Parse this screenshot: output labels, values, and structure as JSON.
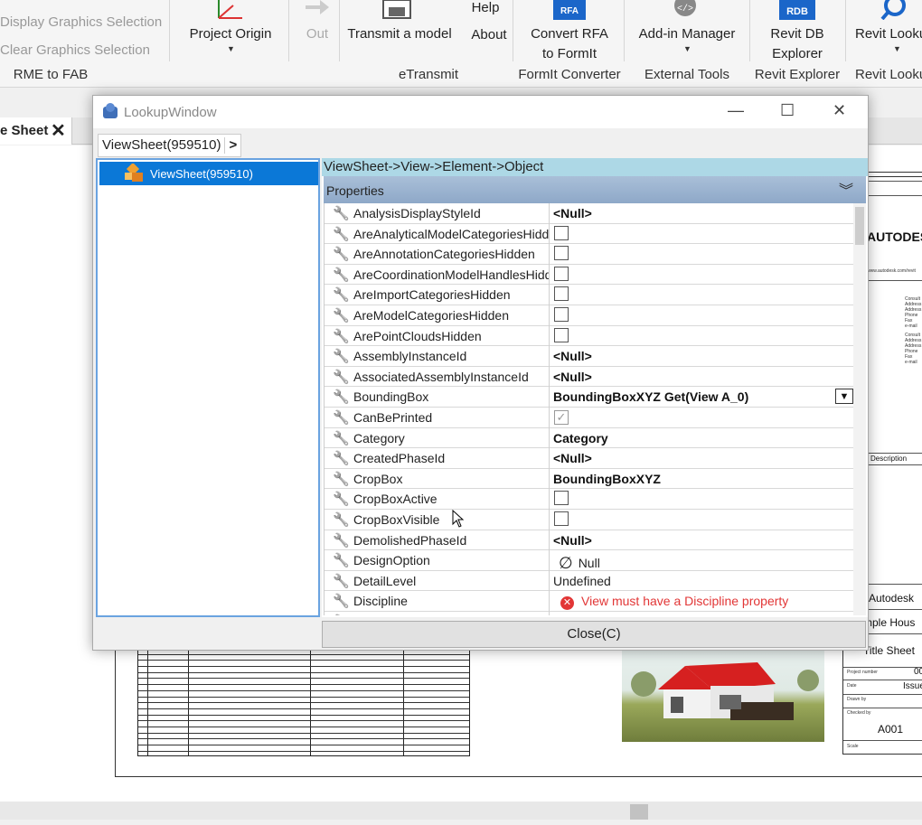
{
  "ribbon": {
    "rme_display": "Display Graphics Selection",
    "rme_clear": "Clear Graphics Selection",
    "rme_panel": "RME to FAB",
    "project_origin": "Project Origin",
    "out": "Out",
    "transmit": "Transmit a model",
    "help": "Help",
    "about": "About",
    "etransmit_panel": "eTransmit",
    "convert_rfa_1": "Convert RFA",
    "convert_rfa_2": "to FormIt",
    "formit_panel": "FormIt Converter",
    "addin_manager": "Add-in Manager",
    "external_panel": "External Tools",
    "revit_db_1": "Revit DB",
    "revit_db_2": "Explorer",
    "revit_explorer_panel": "Revit Explorer",
    "revit_lookup": "Revit Looku",
    "revit_lookup_panel": "Revit Looku",
    "rfa_badge": "RFA",
    "rdb_badge": "RDB"
  },
  "workspace": {
    "tab_label": "e Sheet",
    "tab_close": "✕",
    "tb_company": "AUTODES",
    "tb_url": "www.autodesk.com/revit",
    "tb_desc": "Description",
    "tb_autodesk": "Autodesk",
    "tb_project": "mple Hous",
    "tb_sheet": "Title Sheet",
    "tb_projnum_lbl": "Project number",
    "tb_projnum": "00",
    "tb_date_lbl": "Date",
    "tb_issue": "Issue",
    "tb_drawn": "Drawn by",
    "tb_checked": "Checked by",
    "tb_sheetnum": "A001",
    "tb_scale": "Scale",
    "tb_consultant_block": [
      "Consult",
      "Address",
      "Address",
      "Phone",
      "Fax",
      "e-mail"
    ]
  },
  "window": {
    "title": "LookupWindow",
    "breadcrumb": "ViewSheet(959510)",
    "breadcrumb_arrow": ">",
    "tree_item": "ViewSheet(959510)",
    "path": "ViewSheet->View->Element->Object",
    "props_header": "Properties",
    "close_label": "Close(C)",
    "controls": {
      "minimize": "—",
      "maximize": "☐",
      "close": "✕"
    }
  },
  "properties": [
    {
      "name": "AnalysisDisplayStyleId",
      "type": "bold",
      "value": "<Null>"
    },
    {
      "name": "AreAnalyticalModelCategoriesHidden",
      "type": "checkbox",
      "value": ""
    },
    {
      "name": "AreAnnotationCategoriesHidden",
      "type": "checkbox",
      "value": ""
    },
    {
      "name": "AreCoordinationModelHandlesHidden",
      "type": "checkbox",
      "value": ""
    },
    {
      "name": "AreImportCategoriesHidden",
      "type": "checkbox",
      "value": ""
    },
    {
      "name": "AreModelCategoriesHidden",
      "type": "checkbox",
      "value": ""
    },
    {
      "name": "ArePointCloudsHidden",
      "type": "checkbox",
      "value": ""
    },
    {
      "name": "AssemblyInstanceId",
      "type": "bold",
      "value": "<Null>"
    },
    {
      "name": "AssociatedAssemblyInstanceId",
      "type": "bold",
      "value": "<Null>"
    },
    {
      "name": "BoundingBox",
      "type": "dropdown",
      "value": "BoundingBoxXYZ Get(View A_0)"
    },
    {
      "name": "CanBePrinted",
      "type": "checked",
      "value": "✓"
    },
    {
      "name": "Category",
      "type": "bold",
      "value": "Category"
    },
    {
      "name": "CreatedPhaseId",
      "type": "bold",
      "value": "<Null>"
    },
    {
      "name": "CropBox",
      "type": "bold",
      "value": "BoundingBoxXYZ"
    },
    {
      "name": "CropBoxActive",
      "type": "checkbox",
      "value": ""
    },
    {
      "name": "CropBoxVisible",
      "type": "checkbox",
      "value": ""
    },
    {
      "name": "DemolishedPhaseId",
      "type": "bold",
      "value": "<Null>"
    },
    {
      "name": "DesignOption",
      "type": "null",
      "value": "Null"
    },
    {
      "name": "DetailLevel",
      "type": "text",
      "value": "Undefined"
    },
    {
      "name": "Discipline",
      "type": "error",
      "value": "View must have a Discipline property"
    },
    {
      "name": "DisplayStyle",
      "type": "text",
      "value": ""
    }
  ],
  "icons": {
    "property": "wrench-icon",
    "tree": "viewsheet-icon",
    "app": "lookup-app-icon"
  }
}
